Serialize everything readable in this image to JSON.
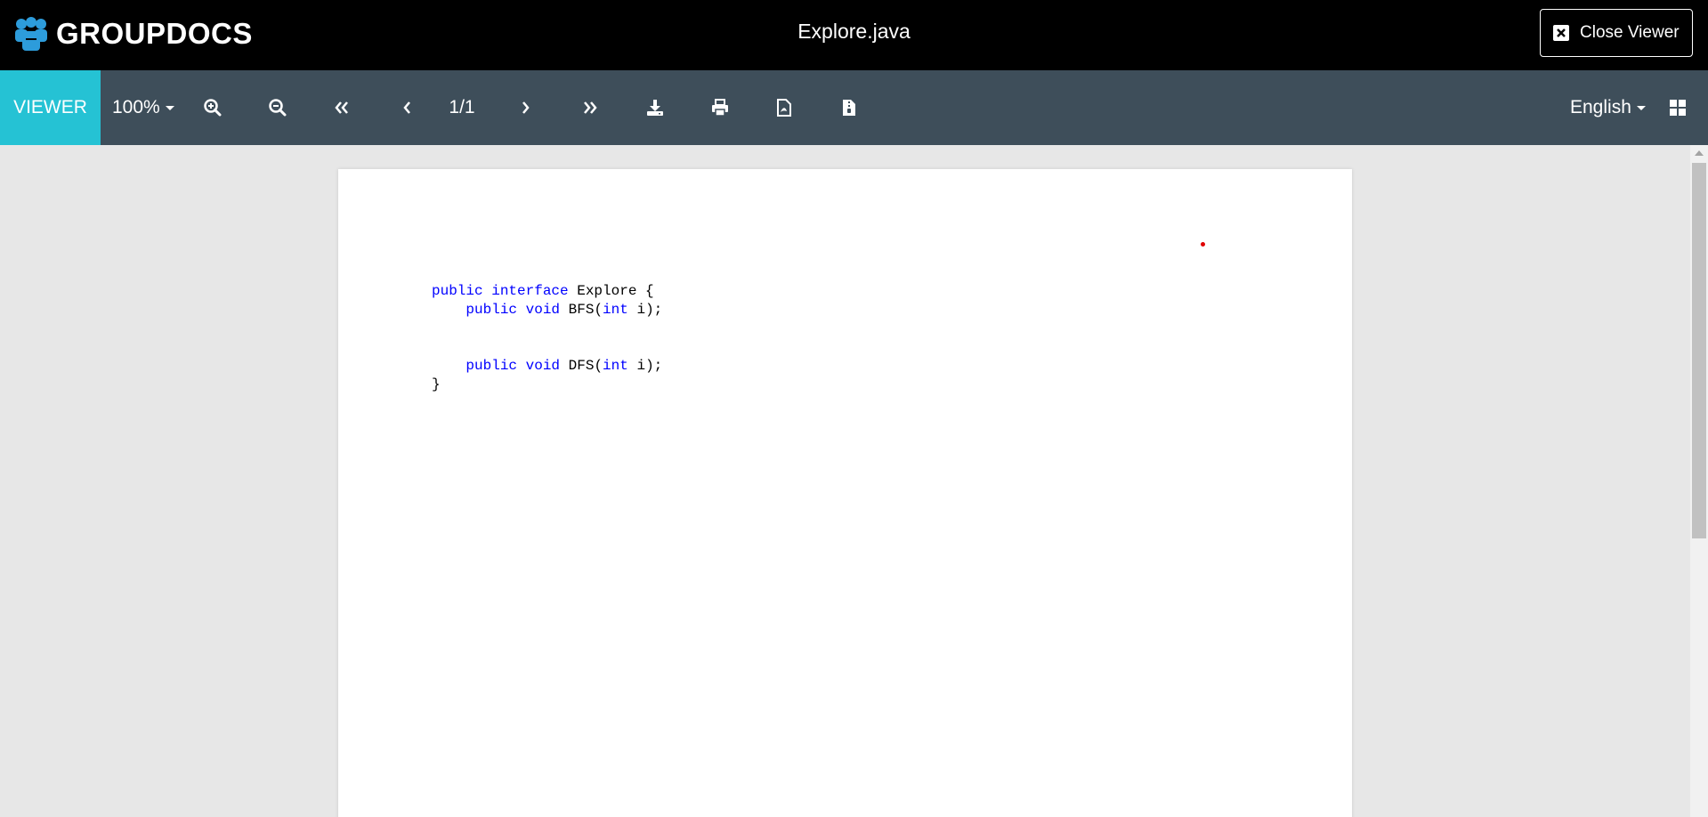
{
  "header": {
    "logo_text": "GROUPDOCS",
    "file_name": "Explore.java",
    "close_label": "Close Viewer"
  },
  "toolbar": {
    "viewer_tab": "VIEWER",
    "zoom_value": "100%",
    "page_indicator": "1/1",
    "language": "English",
    "icons": [
      "zoom-in-icon",
      "zoom-out-icon",
      "first-page-icon",
      "previous-page-icon",
      "next-page-icon",
      "last-page-icon",
      "download-icon",
      "print-icon",
      "pdf-icon",
      "file-info-icon",
      "thumbnails-grid-icon"
    ]
  },
  "document": {
    "code_lines": [
      {
        "parts": [
          {
            "t": "public interface",
            "kw": true
          },
          {
            "t": " Explore {",
            "kw": false
          }
        ]
      },
      {
        "parts": [
          {
            "t": "    ",
            "kw": false
          },
          {
            "t": "public void",
            "kw": true
          },
          {
            "t": " BFS(",
            "kw": false
          },
          {
            "t": "int",
            "kw": true
          },
          {
            "t": " i);",
            "kw": false
          }
        ]
      },
      {
        "parts": [
          {
            "t": "",
            "kw": false
          }
        ]
      },
      {
        "parts": [
          {
            "t": "",
            "kw": false
          }
        ]
      },
      {
        "parts": [
          {
            "t": "    ",
            "kw": false
          },
          {
            "t": "public void",
            "kw": true
          },
          {
            "t": " DFS(",
            "kw": false
          },
          {
            "t": "int",
            "kw": true
          },
          {
            "t": " i);",
            "kw": false
          }
        ]
      },
      {
        "parts": [
          {
            "t": "}",
            "kw": false
          }
        ]
      }
    ]
  },
  "colors": {
    "header_bg": "#000000",
    "toolbar_bg": "#3e4e5a",
    "accent": "#25c2d4",
    "logo_blue": "#2d9cdb",
    "keyword": "#0000ff"
  }
}
